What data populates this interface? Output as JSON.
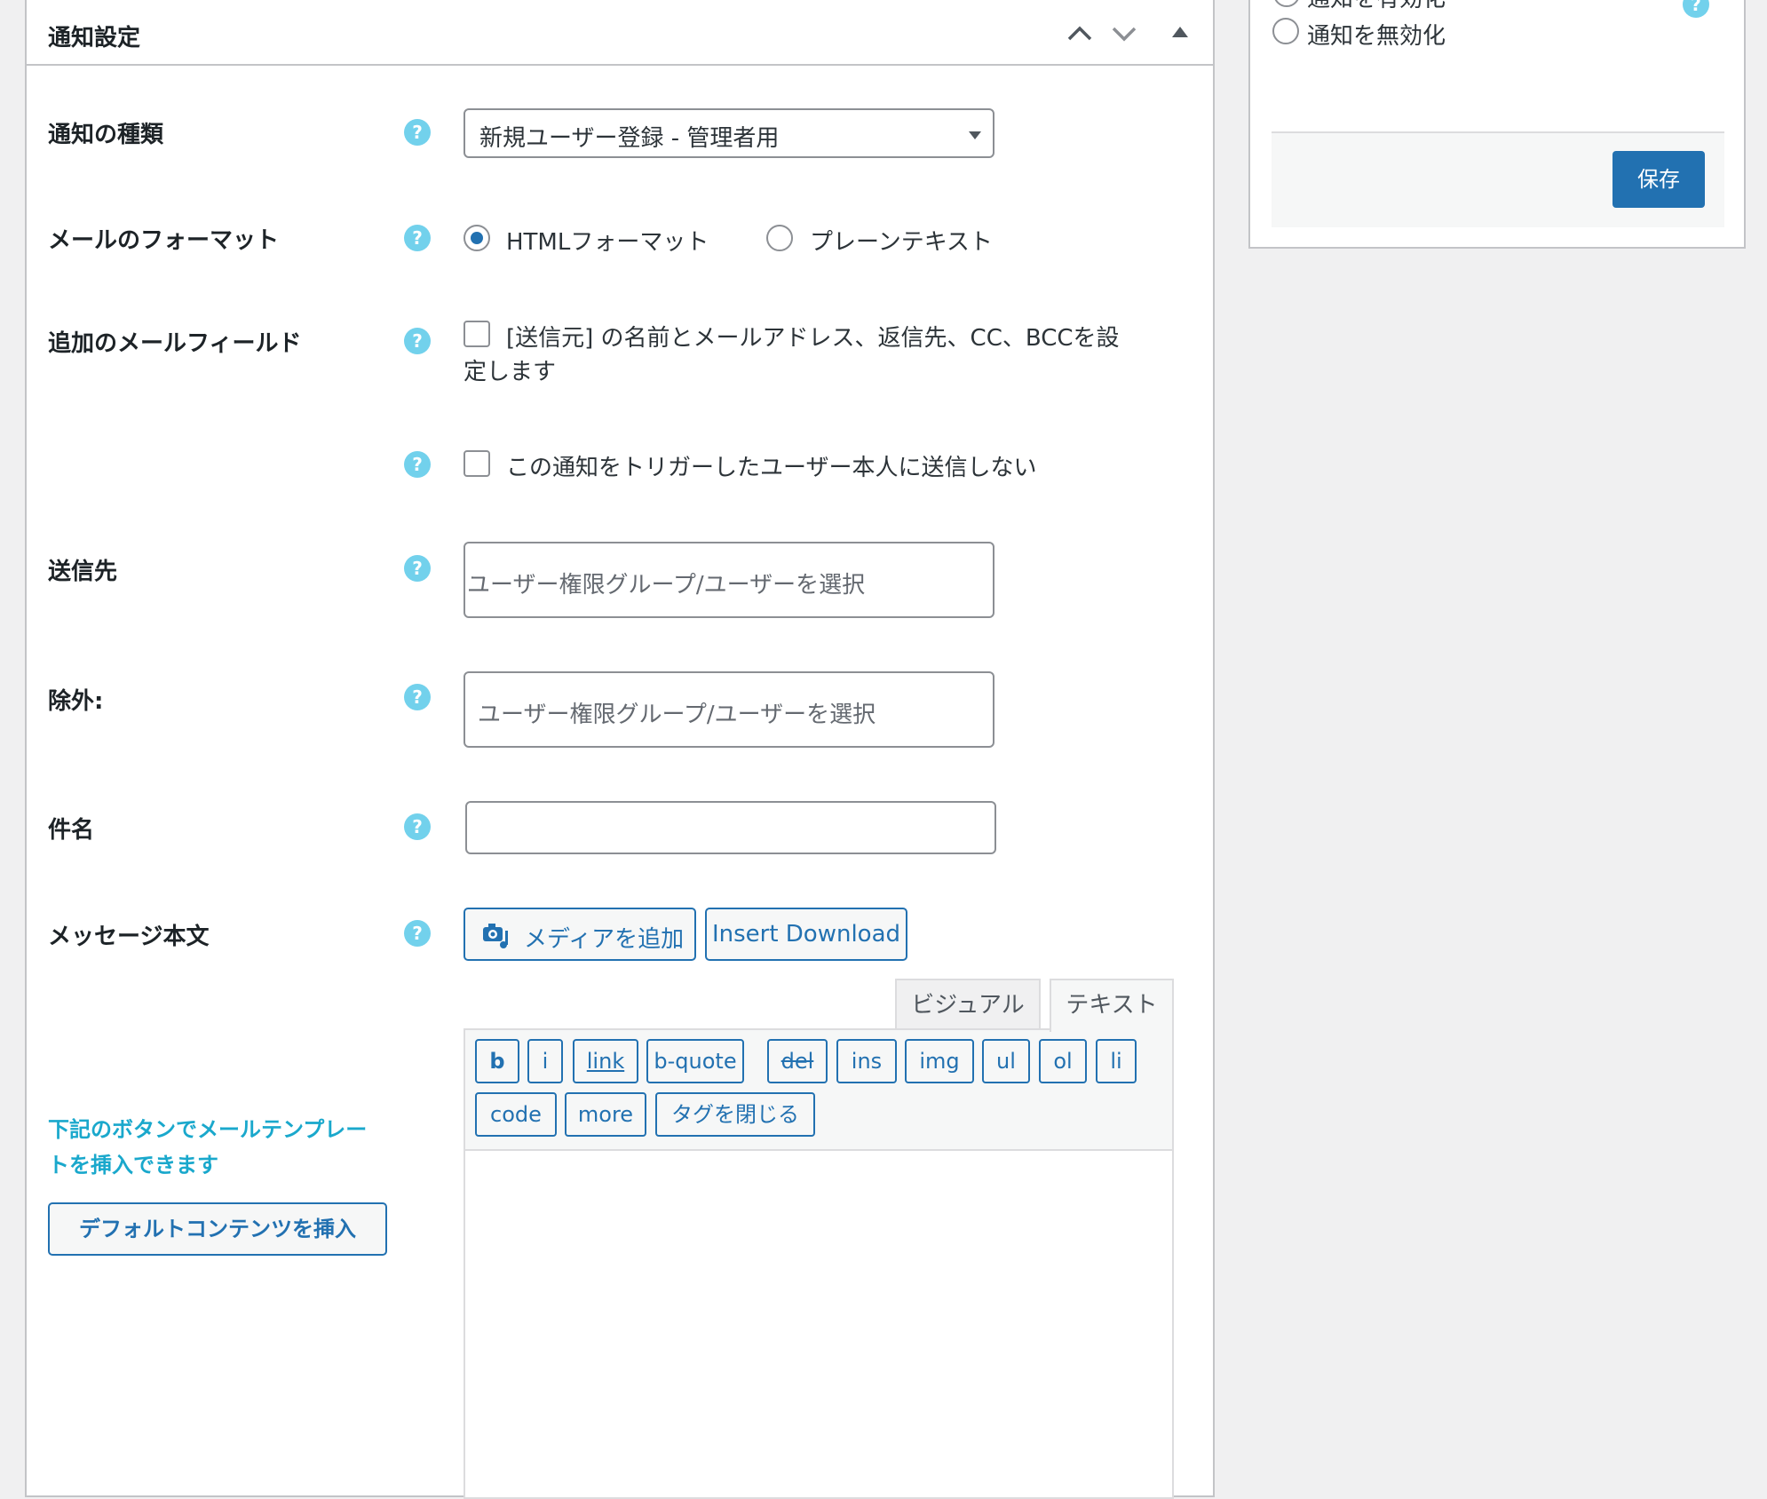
{
  "panel": {
    "title": "通知設定",
    "controls": {
      "up_icon": "chevron-up",
      "down_icon": "chevron-down",
      "toggle_icon": "triangle-up"
    }
  },
  "fields": {
    "type": {
      "label": "通知の種類",
      "value": "新規ユーザー登録 - 管理者用"
    },
    "format": {
      "label": "メールのフォーマット",
      "option_html": "HTMLフォーマット",
      "option_plain": "プレーンテキスト",
      "selected": "html"
    },
    "extra": {
      "label": "追加のメールフィールド",
      "checkbox_line1": "[送信元] の名前とメールアドレス、返信先、CC、BCCを設",
      "checkbox_line2": "定します",
      "checked": false
    },
    "no_self": {
      "checkbox": "この通知をトリガーしたユーザー本人に送信しない",
      "checked": false
    },
    "to": {
      "label": "送信先",
      "placeholder": "ユーザー権限グループ/ユーザーを選択"
    },
    "exclude": {
      "label": "除外:",
      "placeholder": "ユーザー権限グループ/ユーザーを選択"
    },
    "subject": {
      "label": "件名",
      "value": ""
    },
    "message": {
      "label": "メッセージ本文"
    }
  },
  "help_icon": "?",
  "editor": {
    "add_media": "メディアを追加",
    "insert_download": "Insert Download",
    "tabs": {
      "visual": "ビジュアル",
      "text": "テキスト",
      "active": "text"
    },
    "quicktags_row1": [
      "b",
      "i",
      "link",
      "b-quote",
      "del",
      "ins",
      "img",
      "ul",
      "ol",
      "li"
    ],
    "quicktags_row2": [
      "code",
      "more",
      "タグを閉じる"
    ]
  },
  "template": {
    "hint_line1": "下記のボタンでメールテンプレー",
    "hint_line2": "トを挿入できます",
    "button": "デフォルトコンテンツを挿入"
  },
  "side": {
    "enable_label": "通知を有効化",
    "disable_label": "通知を無効化",
    "save": "保存"
  },
  "colors": {
    "accent": "#2271b1",
    "help": "#72d1ec",
    "hint": "#1aa8cc"
  }
}
